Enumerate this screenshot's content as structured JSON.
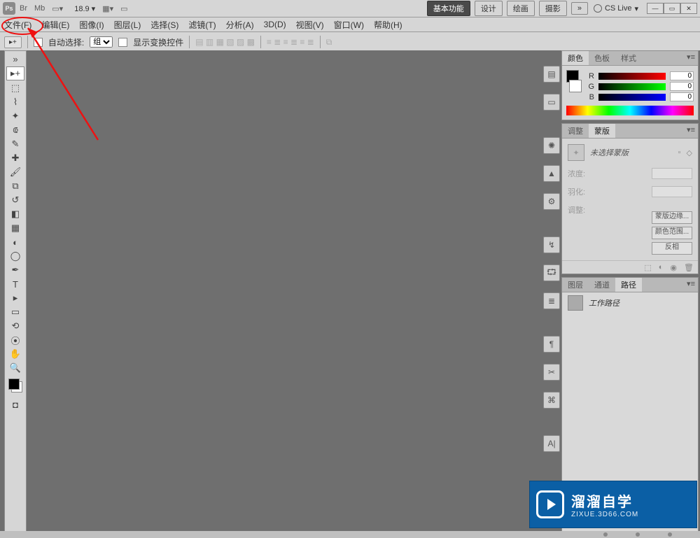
{
  "topbar": {
    "logo": "Ps",
    "icons": [
      "Br",
      "Mb"
    ],
    "zoom": "18.9",
    "workspaces": {
      "active": "基本功能",
      "others": [
        "设计",
        "绘画",
        "摄影"
      ],
      "more": "»"
    },
    "cslive": "CS Live",
    "winctl": {
      "min": "—",
      "max": "▭",
      "close": "✕"
    }
  },
  "menu": {
    "file": "文件(F)",
    "edit": "编辑(E)",
    "image": "图像(I)",
    "layer": "图层(L)",
    "select": "选择(S)",
    "filter": "滤镜(T)",
    "analysis": "分析(A)",
    "threed": "3D(D)",
    "view": "视图(V)",
    "window": "窗口(W)",
    "help": "帮助(H)"
  },
  "options": {
    "tool": "▸+",
    "autoselect_label": "自动选择:",
    "autoselect_value": "组",
    "show_transform": "显示变换控件"
  },
  "tools": {
    "list": [
      "▭",
      "▦",
      "⬚",
      "⤢",
      "✂",
      "✎",
      "✔",
      "⧈",
      "▤",
      "◌",
      "●",
      "◧",
      "T",
      "▸",
      "⬠",
      "✋",
      "⬚",
      "🔍"
    ]
  },
  "rightdock": {
    "groups": [
      "▤",
      "▭",
      "✺",
      "▲",
      "⚙",
      "↯",
      "⮔",
      "≣",
      "¶",
      "✂",
      "⌘",
      "A|"
    ]
  },
  "color_panel": {
    "tabs": {
      "color": "颜色",
      "swatches": "色板",
      "styles": "样式"
    },
    "r": {
      "label": "R",
      "value": "0"
    },
    "g": {
      "label": "G",
      "value": "0"
    },
    "b": {
      "label": "B",
      "value": "0"
    }
  },
  "mask_panel": {
    "tabs": {
      "adjust": "调整",
      "mask": "蒙版"
    },
    "none_selected": "未选择蒙版",
    "density": "浓度:",
    "feather": "羽化:",
    "refine_label": "调整:",
    "mask_edge": "蒙版边缘...",
    "color_range": "颜色范围...",
    "invert": "反相"
  },
  "layer_panel": {
    "tabs": {
      "layers": "图层",
      "channels": "通道",
      "paths": "路径"
    },
    "item": "工作路径"
  },
  "branding": {
    "title": "溜溜自学",
    "sub": "ZIXUE.3D66.COM"
  }
}
